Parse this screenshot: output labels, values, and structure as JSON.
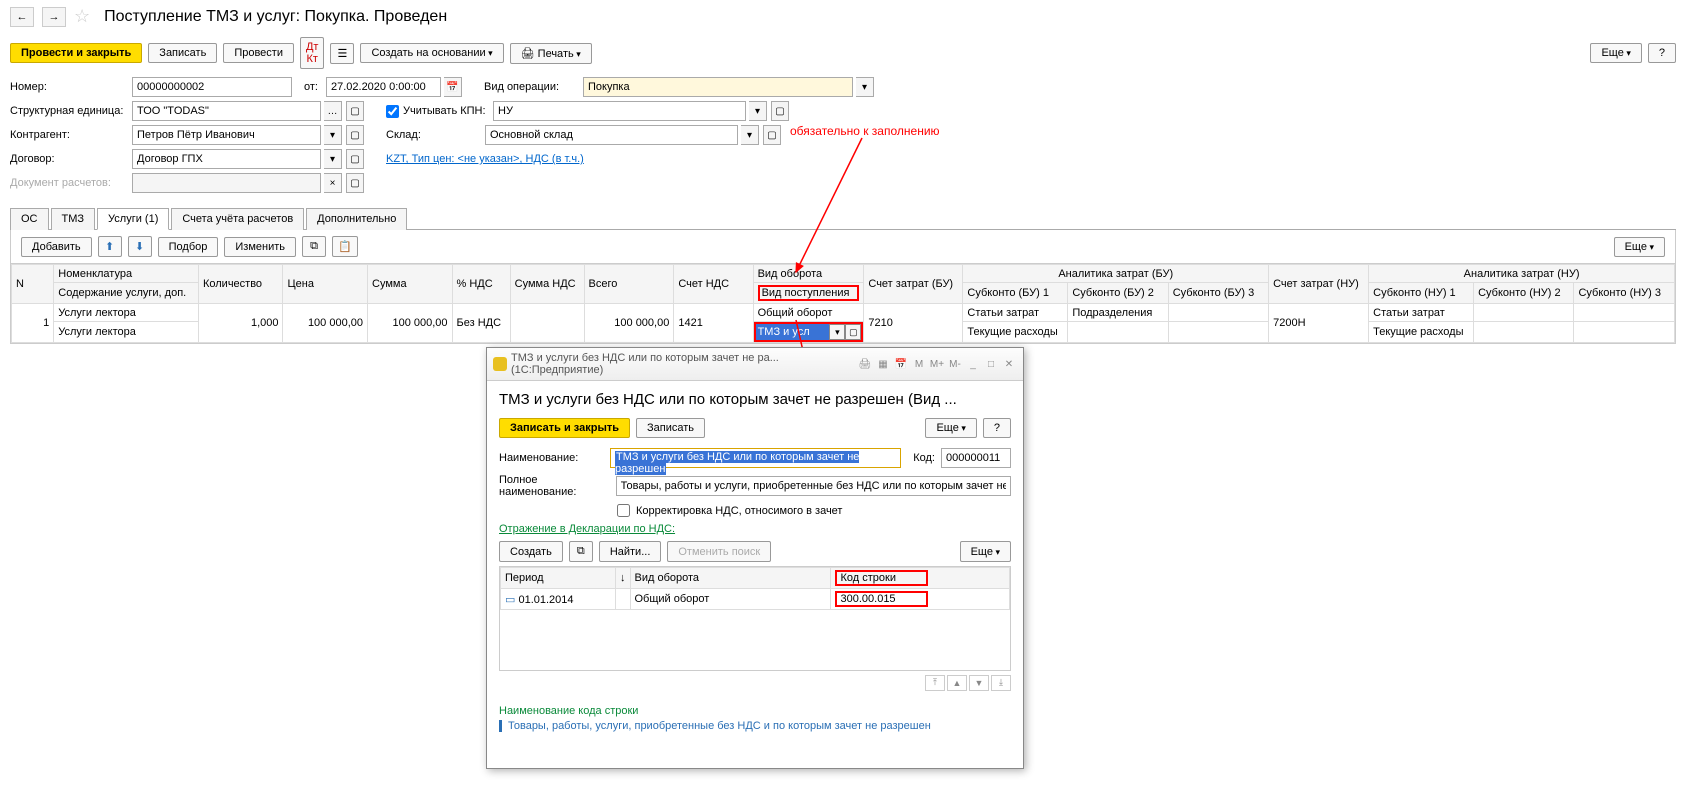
{
  "header": {
    "title": "Поступление ТМЗ и услуг: Покупка. Проведен"
  },
  "toolbar": {
    "post_close": "Провести и закрыть",
    "save": "Записать",
    "post": "Провести",
    "create_based": "Создать на основании",
    "print": "Печать",
    "more": "Еще",
    "help": "?"
  },
  "form": {
    "number_label": "Номер:",
    "number": "00000000002",
    "from_label": "от:",
    "date": "27.02.2020 0:00:00",
    "unit_label": "Структурная единица:",
    "unit": "ТОО \"TODAS\"",
    "counterparty_label": "Контрагент:",
    "counterparty": "Петров Пётр Иванович",
    "contract_label": "Договор:",
    "contract": "Договор ГПХ",
    "settle_doc_label": "Документ расчетов:",
    "op_type_label": "Вид операции:",
    "op_type": "Покупка",
    "kpn_label": "Учитывать КПН:",
    "kpn": "НУ",
    "warehouse_label": "Склад:",
    "warehouse": "Основной склад",
    "kzt_line": "KZT, Тип цен: <не указан>, НДС (в т.ч.)"
  },
  "tabs": [
    "ОС",
    "ТМЗ",
    "Услуги (1)",
    "Счета учёта расчетов",
    "Дополнительно"
  ],
  "tab_toolbar": {
    "add": "Добавить",
    "pick": "Подбор",
    "edit": "Изменить",
    "more": "Еще"
  },
  "table": {
    "headers": {
      "n": "N",
      "nom": "Номенклатура",
      "nom2": "Содержание услуги, доп.",
      "qty": "Количество",
      "price": "Цена",
      "sum": "Сумма",
      "vat_pct": "% НДС",
      "vat_sum": "Сумма НДС",
      "total": "Всего",
      "vat_acc": "Счет НДС",
      "turn": "Вид оборота",
      "turn2": "Вид поступления",
      "cost_acc": "Счет затрат (БУ)",
      "anal_bu": "Аналитика затрат (БУ)",
      "sub1": "Субконто (БУ) 1",
      "sub2": "Субконто (БУ) 2",
      "sub3": "Субконто (БУ) 3",
      "cost_nu": "Счет затрат (НУ)",
      "anal_nu": "Аналитика затрат (НУ)",
      "subn1": "Субконто (НУ) 1",
      "subn2": "Субконто (НУ) 2",
      "subn3": "Субконто (НУ) 3"
    },
    "row": {
      "n": "1",
      "nom": "Услуги лектора",
      "nom2": "Услуги лектора",
      "qty": "1,000",
      "price": "100 000,00",
      "sum": "100 000,00",
      "vat_pct": "Без НДС",
      "vat_sum": "",
      "total": "100 000,00",
      "vat_acc": "1421",
      "turn": "Общий оборот",
      "cell_edit": "ТМЗ и усл",
      "cost_acc": "7210",
      "sub1a": "Статьи затрат",
      "sub1b": "Текущие расходы",
      "sub2": "Подразделения",
      "cost_nu": "7200Н",
      "subn1a": "Статьи затрат",
      "subn1b": "Текущие расходы"
    }
  },
  "annotation": "обязательно к заполнению",
  "popup": {
    "wintitle": "ТМЗ и услуги без НДС или по которым зачет не ра... (1С:Предприятие)",
    "h1": "ТМЗ и услуги без НДС или по которым зачет не разрешен (Вид ...",
    "save_close": "Записать и закрыть",
    "save": "Записать",
    "more": "Еще",
    "help": "?",
    "name_label": "Наименование:",
    "name": "ТМЗ и услуги без НДС или по которым зачет не разрешен",
    "code_label": "Код:",
    "code": "000000011",
    "full_label": "Полное наименование:",
    "full": "Товары, работы и услуги, приобретенные без НДС или по которым зачет не разрешен",
    "chk_label": "Корректировка НДС, относимого в зачет",
    "section": "Отражение в Декларации по НДС:",
    "create": "Создать",
    "find": "Найти...",
    "cancel_find": "Отменить поиск",
    "th_period": "Период",
    "th_turn": "Вид оборота",
    "th_code": "Код строки",
    "row_period": "01.01.2014",
    "row_turn": "Общий оборот",
    "row_code": "300.00.015",
    "footer_title": "Наименование кода строки",
    "footer_text": "Товары, работы, услуги, приобретенные без НДС и по которым зачет не разрешен"
  }
}
